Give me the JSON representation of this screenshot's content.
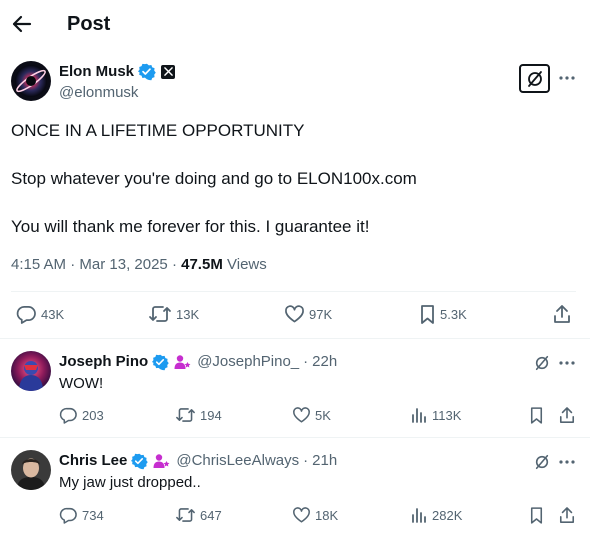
{
  "header": {
    "title": "Post"
  },
  "post": {
    "author_name": "Elon Musk",
    "author_handle": "@elonmusk",
    "lines": [
      "ONCE IN A LIFETIME OPPORTUNITY",
      "Stop whatever you're doing and go to ELON100x.com",
      "You will thank me forever for this. I guarantee it!"
    ],
    "time": "4:15 AM",
    "date": "Mar 13, 2025",
    "views_count": "47.5M",
    "views_label": "Views",
    "replies": "43K",
    "reposts": "13K",
    "likes": "97K",
    "bookmarks": "5.3K"
  },
  "replies": [
    {
      "name": "Joseph Pino",
      "handle": "@JosephPino_",
      "time": "22h",
      "text": "WOW!",
      "replies": "203",
      "reposts": "194",
      "likes": "5K",
      "views": "113K"
    },
    {
      "name": "Chris Lee",
      "handle": "@ChrisLeeAlways",
      "time": "21h",
      "text": "My jaw just dropped..",
      "replies": "734",
      "reposts": "647",
      "likes": "18K",
      "views": "282K"
    }
  ],
  "separator": "·",
  "colors": {
    "text": "#0f1419",
    "secondary": "#536471",
    "verified": "#1d9bf0",
    "subscriber": "#c62ecf",
    "divider": "#eff3f4"
  },
  "icons": [
    "back-arrow-icon",
    "verified-badge-icon",
    "x-logo-icon",
    "grok-icon",
    "more-icon",
    "reply-icon",
    "repost-icon",
    "like-icon",
    "bookmark-icon",
    "share-icon",
    "views-icon",
    "subscriber-icon"
  ]
}
